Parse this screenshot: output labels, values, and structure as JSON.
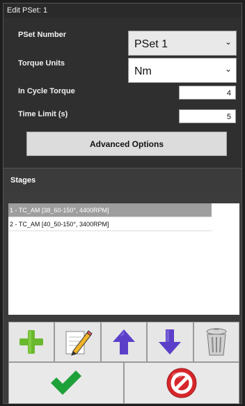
{
  "window": {
    "title": "Edit PSet: 1"
  },
  "form": {
    "pset_number": {
      "label": "PSet Number",
      "value": "PSet 1"
    },
    "torque_units": {
      "label": "Torque Units",
      "value": "Nm"
    },
    "in_cycle_torque": {
      "label": "In Cycle Torque",
      "value": "4"
    },
    "time_limit": {
      "label": "Time Limit (s)",
      "value": "5"
    },
    "advanced_button": "Advanced Options"
  },
  "stages": {
    "header": "Stages",
    "items": [
      {
        "label": "1 - TC_AM [38_60-150°, 4400RPM]",
        "selected": true
      },
      {
        "label": "2 - TC_AM [40_50-150°, 3400RPM]",
        "selected": false
      }
    ]
  },
  "toolbar": {
    "icons": [
      "add-icon",
      "edit-icon",
      "move-up-icon",
      "move-down-icon",
      "delete-icon"
    ]
  },
  "actions": {
    "icons": [
      "confirm-icon",
      "cancel-icon"
    ]
  },
  "colors": {
    "add": "#6ab82e",
    "arrow": "#5b3fc9",
    "confirm": "#1fa13a",
    "cancel": "#d7262b"
  }
}
